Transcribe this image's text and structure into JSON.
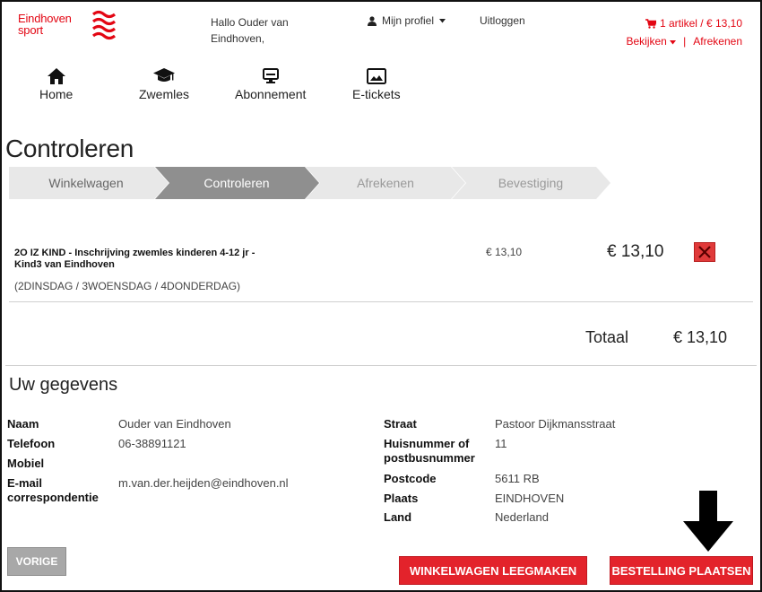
{
  "brand": {
    "line1": "Eindhoven",
    "line2": "sport",
    "color": "#e30613"
  },
  "header": {
    "greeting": "Hallo Ouder van Eindhoven,",
    "profile_label": "Mijn profiel",
    "logout_label": "Uitloggen",
    "cart_summary": "1 artikel / € 13,10",
    "cart_view": "Bekijken",
    "cart_checkout": "Afrekenen"
  },
  "nav": [
    {
      "label": "Home",
      "icon": "home-icon"
    },
    {
      "label": "Zwemles",
      "icon": "graduation-cap-icon"
    },
    {
      "label": "Abonnement",
      "icon": "monitor-icon"
    },
    {
      "label": "E-tickets",
      "icon": "image-icon"
    }
  ],
  "page_title": "Controleren",
  "steps": [
    {
      "label": "Winkelwagen",
      "state": "done"
    },
    {
      "label": "Controleren",
      "state": "active"
    },
    {
      "label": "Afrekenen",
      "state": "todo"
    },
    {
      "label": "Bevestiging",
      "state": "todo"
    }
  ],
  "item": {
    "title": "2O IZ KIND - Inschrijving zwemles kinderen 4-12 jr - Kind3 van Eindhoven",
    "subtitle": "(2DINSDAG / 3WOENSDAG / 4DONDERDAG)",
    "unit_price": "€ 13,10",
    "line_total": "€ 13,10"
  },
  "total": {
    "label": "Totaal",
    "value": "€ 13,10"
  },
  "details": {
    "title": "Uw gegevens",
    "left": [
      {
        "label": "Naam",
        "value": "Ouder van Eindhoven"
      },
      {
        "label": "Telefoon",
        "value": "06-38891121"
      },
      {
        "label": "Mobiel",
        "value": ""
      },
      {
        "label": "E-mail correspondentie",
        "value": "m.van.der.heijden@eindhoven.nl"
      }
    ],
    "right": [
      {
        "label": "Straat",
        "value": "Pastoor Dijkmansstraat"
      },
      {
        "label": "Huisnummer of postbusnummer",
        "value": "11"
      },
      {
        "label": "Postcode",
        "value": "5611 RB"
      },
      {
        "label": "Plaats",
        "value": "EINDHOVEN"
      },
      {
        "label": "Land",
        "value": "Nederland"
      }
    ]
  },
  "buttons": {
    "previous": "VORIGE",
    "clear_cart": "WINKELWAGEN LEEGMAKEN",
    "place_order": "BESTELLING PLAATSEN"
  },
  "colors": {
    "accent": "#e3232b",
    "step_active": "#8f8f8f",
    "step_inactive": "#e8e8e8"
  }
}
